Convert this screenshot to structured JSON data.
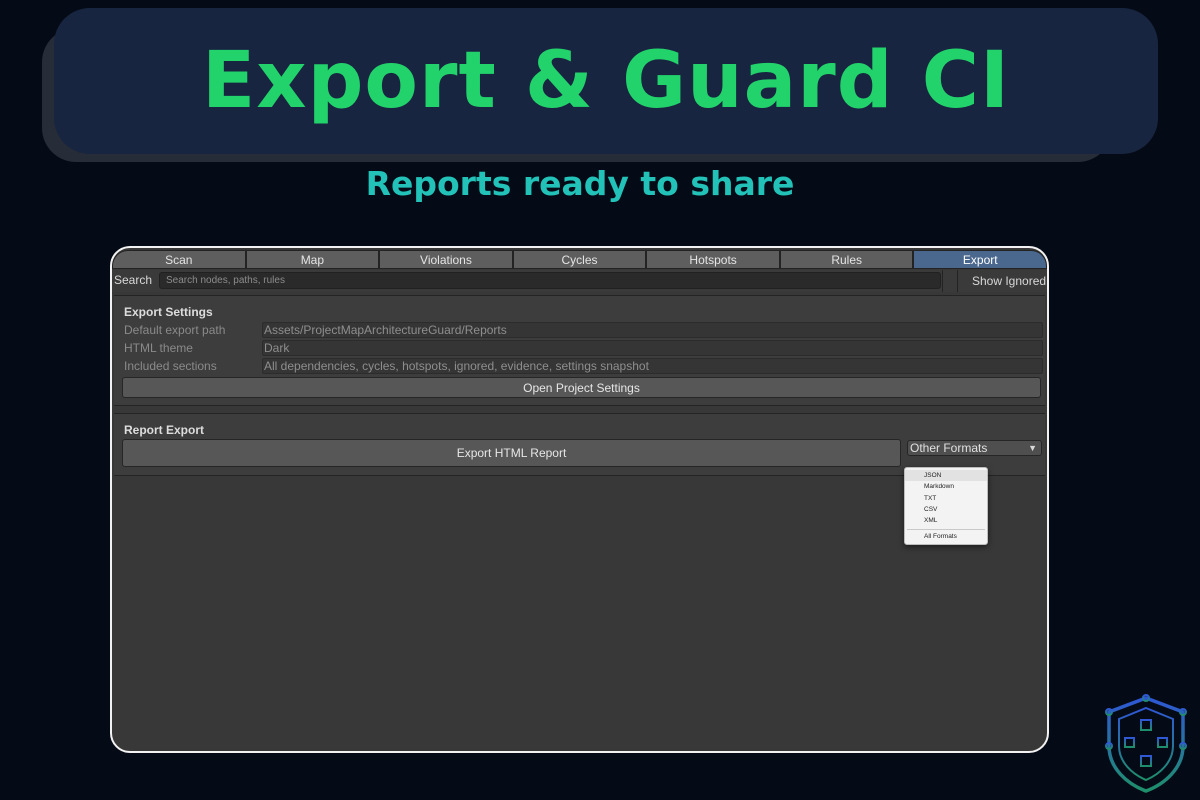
{
  "banner": {
    "title": "Export & Guard CI",
    "subtitle": "Reports ready to share"
  },
  "tabs": [
    {
      "label": "Scan"
    },
    {
      "label": "Map"
    },
    {
      "label": "Violations"
    },
    {
      "label": "Cycles"
    },
    {
      "label": "Hotspots"
    },
    {
      "label": "Rules"
    },
    {
      "label": "Export",
      "active": true
    }
  ],
  "search": {
    "label": "Search",
    "placeholder": "Search nodes, paths, rules",
    "show_ignored": "Show Ignored"
  },
  "export_settings": {
    "title": "Export Settings",
    "default_path_label": "Default export path",
    "default_path_value": "Assets/ProjectMapArchitectureGuard/Reports",
    "theme_label": "HTML theme",
    "theme_value": "Dark",
    "sections_label": "Included sections",
    "sections_value": "All dependencies, cycles, hotspots, ignored, evidence, settings snapshot",
    "open_settings_button": "Open Project Settings"
  },
  "report_export": {
    "title": "Report Export",
    "export_html_button": "Export HTML Report",
    "formats_dropdown": "Other Formats"
  },
  "formats_menu": {
    "items": [
      "JSON",
      "Markdown",
      "TXT",
      "CSV",
      "XML"
    ],
    "all": "All Formats",
    "highlighted": "JSON"
  },
  "colors": {
    "background": "#050b16",
    "banner": "#182540",
    "title": "#22d36b",
    "subtitle": "#22c2b8",
    "active_tab": "#4a678e",
    "panel": "#383838"
  }
}
